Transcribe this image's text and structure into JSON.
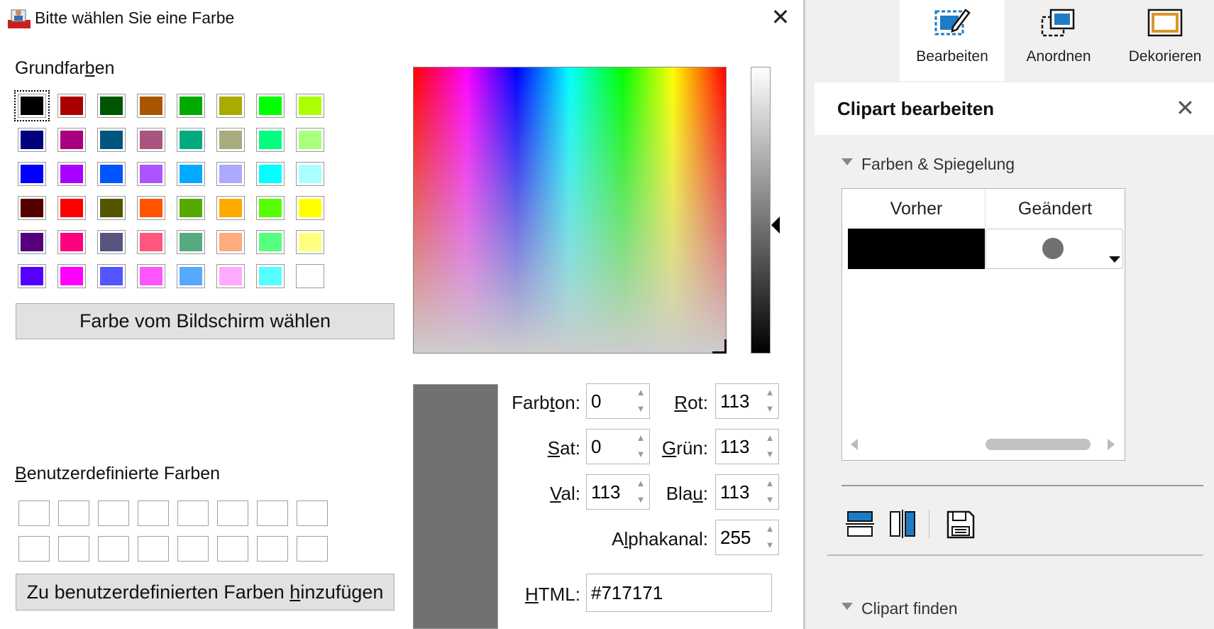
{
  "dialog": {
    "title": "Bitte wählen Sie eine Farbe",
    "basic_label": "Grundfarben",
    "basic_colors": [
      [
        "#000000",
        "#aa0000",
        "#005500",
        "#aa5500",
        "#00aa00",
        "#aaaa00",
        "#00ff00",
        "#aaff00"
      ],
      [
        "#00007f",
        "#aa007f",
        "#00557f",
        "#aa557f",
        "#00aa7f",
        "#aaaa7f",
        "#00ff7f",
        "#aaff7f"
      ],
      [
        "#0000ff",
        "#aa00ff",
        "#0055ff",
        "#aa55ff",
        "#00aaff",
        "#aaaaff",
        "#00ffff",
        "#aaffff"
      ],
      [
        "#550000",
        "#ff0000",
        "#555500",
        "#ff5500",
        "#55aa00",
        "#ffaa00",
        "#55ff00",
        "#ffff00"
      ],
      [
        "#55007f",
        "#ff007f",
        "#55557f",
        "#ff557f",
        "#55aa7f",
        "#ffaa7f",
        "#55ff7f",
        "#ffff7f"
      ],
      [
        "#5500ff",
        "#ff00ff",
        "#5555ff",
        "#ff55ff",
        "#55aaff",
        "#ffaaff",
        "#55ffff",
        "#ffffff"
      ]
    ],
    "pick_screen_button": "Farbe vom Bildschirm wählen",
    "custom_label": "Benutzerdefinierte Farben",
    "add_custom_button": "Zu benutzerdefinierten Farben hinzufügen",
    "preview_color": "#717171",
    "fields": {
      "hue": {
        "label": "Farbton:",
        "value": "0"
      },
      "sat": {
        "label": "Sat:",
        "value": "0"
      },
      "val": {
        "label": "Val:",
        "value": "113"
      },
      "red": {
        "label": "Rot:",
        "value": "113"
      },
      "green": {
        "label": "Grün:",
        "value": "113"
      },
      "blue": {
        "label": "Blau:",
        "value": "113"
      },
      "alpha": {
        "label": "Alphakanal:",
        "value": "255"
      },
      "html": {
        "label": "HTML:",
        "value": "#717171"
      }
    }
  },
  "sidebar": {
    "tabs": [
      {
        "label": "Bearbeiten",
        "icon": "edit-icon"
      },
      {
        "label": "Anordnen",
        "icon": "arrange-icon"
      },
      {
        "label": "Dekorieren",
        "icon": "decorate-icon"
      }
    ],
    "panel_title": "Clipart bearbeiten",
    "section_colors": "Farben & Spiegelung",
    "table": {
      "col_before": "Vorher",
      "col_changed": "Geändert",
      "before_color": "#000000",
      "changed_color": "#707070"
    },
    "section_find": "Clipart finden"
  }
}
